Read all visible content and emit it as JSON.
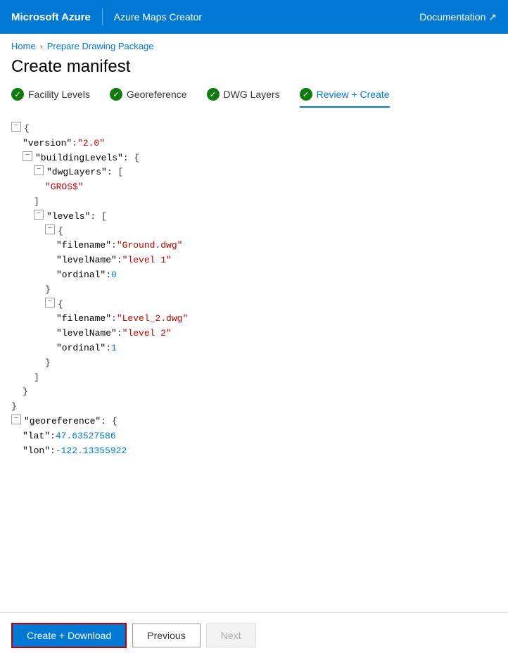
{
  "topbar": {
    "brand": "Microsoft Azure",
    "sub": "Azure Maps Creator",
    "doc_link": "Documentation ↗"
  },
  "breadcrumb": {
    "home": "Home",
    "current": "Prepare Drawing Package"
  },
  "page_title": "Create manifest",
  "tabs": [
    {
      "id": "facility-levels",
      "label": "Facility Levels",
      "checked": true,
      "active": false
    },
    {
      "id": "georeference",
      "label": "Georeference",
      "checked": true,
      "active": false
    },
    {
      "id": "dwg-layers",
      "label": "DWG Layers",
      "checked": true,
      "active": false
    },
    {
      "id": "review-create",
      "label": "Review + Create",
      "checked": true,
      "active": true
    }
  ],
  "json_content": {
    "version": "2.0",
    "buildingLevels": {
      "dwgLayers": [
        "GROS$"
      ],
      "levels": [
        {
          "filename": "Ground.dwg",
          "levelName": "level 1",
          "ordinal": 0
        },
        {
          "filename": "Level_2.dwg",
          "levelName": "level 2",
          "ordinal": 1
        }
      ]
    },
    "georeference": {
      "lat": 47.63527586,
      "lon": -122.13355922
    }
  },
  "footer": {
    "create_download": "Create + Download",
    "previous": "Previous",
    "next": "Next"
  }
}
